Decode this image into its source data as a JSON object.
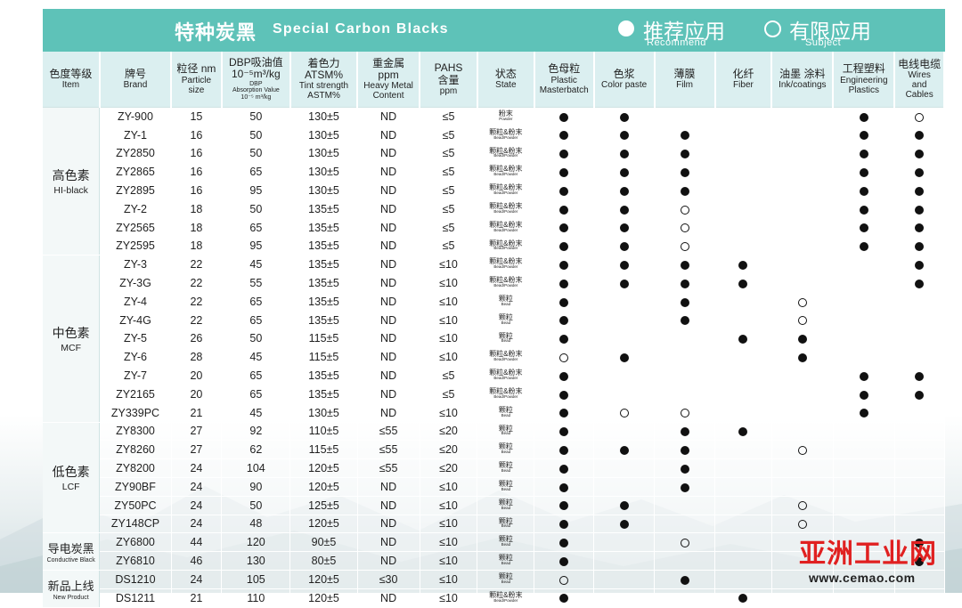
{
  "banner": {
    "title_cn": "特种炭黑",
    "title_en": "Special  Carbon  Blacks",
    "legend_recommend_cn": "推荐应用",
    "legend_recommend_en": "Recommend",
    "legend_subject_cn": "有限应用",
    "legend_subject_en": "Subject",
    "color": "#5ec2b8"
  },
  "header": [
    {
      "cn": "色度等级",
      "en": "Item"
    },
    {
      "cn": "牌号",
      "en": "Brand"
    },
    {
      "cn": "粒径 nm",
      "en": "Particle",
      "en2": "size"
    },
    {
      "cn": "DBP吸油值",
      "cn2": "10⁻⁵m³/kg",
      "en": "DBP",
      "en2": "Absorption Value",
      "en3": "10⁻⁵ m³/kg"
    },
    {
      "cn": "着色力",
      "cn2": "ATSM%",
      "en": "Tint strength",
      "en2": "ASTM%"
    },
    {
      "cn": "重金属",
      "cn2": "ppm",
      "en": "Heavy Metal",
      "en2": "Content"
    },
    {
      "cn": "PAHS",
      "cn2": "含量",
      "en": "ppm"
    },
    {
      "cn": "状态",
      "en": "State"
    },
    {
      "cn": "色母粒",
      "en": "Plastic",
      "en2": "Masterbatch"
    },
    {
      "cn": "色浆",
      "en": "Color paste"
    },
    {
      "cn": "薄膜",
      "en": "Film"
    },
    {
      "cn": "化纤",
      "en": "Fiber"
    },
    {
      "cn": "油墨 涂料",
      "en": "Ink/coatings"
    },
    {
      "cn": "工程塑料",
      "en": "Engineering",
      "en2": "Plastics"
    },
    {
      "cn": "电线电缆",
      "en": "Wires",
      "en2": "and",
      "en3": "Cables"
    }
  ],
  "groups": [
    {
      "cn": "高色素",
      "en": "HI-black",
      "rows": [
        {
          "brand": "ZY-900",
          "size": "15",
          "dbp": "50",
          "tint": "130±5",
          "metal": "ND",
          "pahs": "≤5",
          "state_cn": "粉末",
          "state_en": "Powder",
          "apps": [
            "●",
            "●",
            "",
            "",
            "",
            "●",
            "○"
          ]
        },
        {
          "brand": "ZY-1",
          "size": "16",
          "dbp": "50",
          "tint": "130±5",
          "metal": "ND",
          "pahs": "≤5",
          "state_cn": "颗粒&粉末",
          "state_en": "Bead/Powder",
          "apps": [
            "●",
            "●",
            "●",
            "",
            "",
            "●",
            "●"
          ]
        },
        {
          "brand": "ZY2850",
          "size": "16",
          "dbp": "50",
          "tint": "130±5",
          "metal": "ND",
          "pahs": "≤5",
          "state_cn": "颗粒&粉末",
          "state_en": "Bead/Powder",
          "apps": [
            "●",
            "●",
            "●",
            "",
            "",
            "●",
            "●"
          ]
        },
        {
          "brand": "ZY2865",
          "size": "16",
          "dbp": "65",
          "tint": "130±5",
          "metal": "ND",
          "pahs": "≤5",
          "state_cn": "颗粒&粉末",
          "state_en": "Bead/Powder",
          "apps": [
            "●",
            "●",
            "●",
            "",
            "",
            "●",
            "●"
          ]
        },
        {
          "brand": "ZY2895",
          "size": "16",
          "dbp": "95",
          "tint": "130±5",
          "metal": "ND",
          "pahs": "≤5",
          "state_cn": "颗粒&粉末",
          "state_en": "Bead/Powder",
          "apps": [
            "●",
            "●",
            "●",
            "",
            "",
            "●",
            "●"
          ]
        },
        {
          "brand": "ZY-2",
          "size": "18",
          "dbp": "50",
          "tint": "135±5",
          "metal": "ND",
          "pahs": "≤5",
          "state_cn": "颗粒&粉末",
          "state_en": "Bead/Powder",
          "apps": [
            "●",
            "●",
            "○",
            "",
            "",
            "●",
            "●"
          ]
        },
        {
          "brand": "ZY2565",
          "size": "18",
          "dbp": "65",
          "tint": "135±5",
          "metal": "ND",
          "pahs": "≤5",
          "state_cn": "颗粒&粉末",
          "state_en": "Bead/Powder",
          "apps": [
            "●",
            "●",
            "○",
            "",
            "",
            "●",
            "●"
          ]
        },
        {
          "brand": "ZY2595",
          "size": "18",
          "dbp": "95",
          "tint": "135±5",
          "metal": "ND",
          "pahs": "≤5",
          "state_cn": "颗粒&粉末",
          "state_en": "Bead/Powder",
          "apps": [
            "●",
            "●",
            "○",
            "",
            "",
            "●",
            "●"
          ]
        }
      ]
    },
    {
      "cn": "中色素",
      "en": "MCF",
      "rows": [
        {
          "brand": "ZY-3",
          "size": "22",
          "dbp": "45",
          "tint": "135±5",
          "metal": "ND",
          "pahs": "≤10",
          "state_cn": "颗粒&粉末",
          "state_en": "Bead/Powder",
          "apps": [
            "●",
            "●",
            "●",
            "●",
            "",
            "",
            "●"
          ]
        },
        {
          "brand": "ZY-3G",
          "size": "22",
          "dbp": "55",
          "tint": "135±5",
          "metal": "ND",
          "pahs": "≤10",
          "state_cn": "颗粒&粉末",
          "state_en": "Bead/Powder",
          "apps": [
            "●",
            "●",
            "●",
            "●",
            "",
            "",
            "●"
          ]
        },
        {
          "brand": "ZY-4",
          "size": "22",
          "dbp": "65",
          "tint": "135±5",
          "metal": "ND",
          "pahs": "≤10",
          "state_cn": "颗粒",
          "state_en": "Bead",
          "apps": [
            "●",
            "",
            "●",
            "",
            "○",
            "",
            ""
          ]
        },
        {
          "brand": "ZY-4G",
          "size": "22",
          "dbp": "65",
          "tint": "135±5",
          "metal": "ND",
          "pahs": "≤10",
          "state_cn": "颗粒",
          "state_en": "Bead",
          "apps": [
            "●",
            "",
            "●",
            "",
            "○",
            "",
            ""
          ]
        },
        {
          "brand": "ZY-5",
          "size": "26",
          "dbp": "50",
          "tint": "115±5",
          "metal": "ND",
          "pahs": "≤10",
          "state_cn": "颗粒",
          "state_en": "Bead",
          "apps": [
            "●",
            "",
            "",
            "●",
            "●",
            "",
            ""
          ]
        },
        {
          "brand": "ZY-6",
          "size": "28",
          "dbp": "45",
          "tint": "115±5",
          "metal": "ND",
          "pahs": "≤10",
          "state_cn": "颗粒&粉末",
          "state_en": "Bead/Powder",
          "apps": [
            "○",
            "●",
            "",
            "",
            "●",
            "",
            ""
          ]
        },
        {
          "brand": "ZY-7",
          "size": "20",
          "dbp": "65",
          "tint": "135±5",
          "metal": "ND",
          "pahs": "≤5",
          "state_cn": "颗粒&粉末",
          "state_en": "Bead/Powder",
          "apps": [
            "●",
            "",
            "",
            "",
            "",
            "●",
            "●"
          ]
        },
        {
          "brand": "ZY2165",
          "size": "20",
          "dbp": "65",
          "tint": "135±5",
          "metal": "ND",
          "pahs": "≤5",
          "state_cn": "颗粒&粉末",
          "state_en": "Bead/Powder",
          "apps": [
            "●",
            "",
            "",
            "",
            "",
            "●",
            "●"
          ]
        },
        {
          "brand": "ZY339PC",
          "size": "21",
          "dbp": "45",
          "tint": "130±5",
          "metal": "ND",
          "pahs": "≤10",
          "state_cn": "颗粒",
          "state_en": "Bead",
          "apps": [
            "●",
            "○",
            "○",
            "",
            "",
            "●",
            ""
          ]
        }
      ]
    },
    {
      "cn": "低色素",
      "en": "LCF",
      "rows": [
        {
          "brand": "ZY8300",
          "size": "27",
          "dbp": "92",
          "tint": "110±5",
          "metal": "≤55",
          "pahs": "≤20",
          "state_cn": "颗粒",
          "state_en": "Bead",
          "apps": [
            "●",
            "",
            "●",
            "●",
            "",
            "",
            ""
          ]
        },
        {
          "brand": "ZY8260",
          "size": "27",
          "dbp": "62",
          "tint": "115±5",
          "metal": "≤55",
          "pahs": "≤20",
          "state_cn": "颗粒",
          "state_en": "Bead",
          "apps": [
            "●",
            "●",
            "●",
            "",
            "○",
            "",
            ""
          ]
        },
        {
          "brand": "ZY8200",
          "size": "24",
          "dbp": "104",
          "tint": "120±5",
          "metal": "≤55",
          "pahs": "≤20",
          "state_cn": "颗粒",
          "state_en": "Bead",
          "apps": [
            "●",
            "",
            "●",
            "",
            "",
            "",
            ""
          ]
        },
        {
          "brand": "ZY90BF",
          "size": "24",
          "dbp": "90",
          "tint": "120±5",
          "metal": "ND",
          "pahs": "≤10",
          "state_cn": "颗粒",
          "state_en": "Bead",
          "apps": [
            "●",
            "",
            "●",
            "",
            "",
            "",
            ""
          ]
        },
        {
          "brand": "ZY50PC",
          "size": "24",
          "dbp": "50",
          "tint": "125±5",
          "metal": "ND",
          "pahs": "≤10",
          "state_cn": "颗粒",
          "state_en": "Bead",
          "apps": [
            "●",
            "●",
            "",
            "",
            "○",
            "",
            ""
          ]
        },
        {
          "brand": "ZY148CP",
          "size": "24",
          "dbp": "48",
          "tint": "120±5",
          "metal": "ND",
          "pahs": "≤10",
          "state_cn": "颗粒",
          "state_en": "Bead",
          "apps": [
            "●",
            "●",
            "",
            "",
            "○",
            "",
            ""
          ]
        }
      ]
    },
    {
      "cn": "导电炭黑",
      "en": "Conductive Black",
      "small": true,
      "rows": [
        {
          "brand": "ZY6800",
          "size": "44",
          "dbp": "120",
          "tint": "90±5",
          "metal": "ND",
          "pahs": "≤10",
          "state_cn": "颗粒",
          "state_en": "Bead",
          "apps": [
            "●",
            "",
            "○",
            "",
            "",
            "",
            "●"
          ]
        },
        {
          "brand": "ZY6810",
          "size": "46",
          "dbp": "130",
          "tint": "80±5",
          "metal": "ND",
          "pahs": "≤10",
          "state_cn": "颗粒",
          "state_en": "Bead",
          "apps": [
            "●",
            "",
            "",
            "",
            "",
            "",
            "●"
          ]
        }
      ]
    },
    {
      "cn": "新品上线",
      "en": "New Product",
      "small": true,
      "rows": [
        {
          "brand": "DS1210",
          "size": "24",
          "dbp": "105",
          "tint": "120±5",
          "metal": "≤30",
          "pahs": "≤10",
          "state_cn": "颗粒",
          "state_en": "Bead",
          "apps": [
            "○",
            "",
            "●",
            "",
            "",
            "",
            ""
          ]
        },
        {
          "brand": "DS1211",
          "size": "21",
          "dbp": "110",
          "tint": "120±5",
          "metal": "ND",
          "pahs": "≤10",
          "state_cn": "颗粒&粉末",
          "state_en": "Bead/Powder",
          "apps": [
            "●",
            "",
            "",
            "●",
            "",
            "",
            ""
          ]
        }
      ]
    }
  ],
  "watermark": {
    "text": "亚洲工业网",
    "url": "www.cemao.com",
    "color": "#e02020"
  }
}
